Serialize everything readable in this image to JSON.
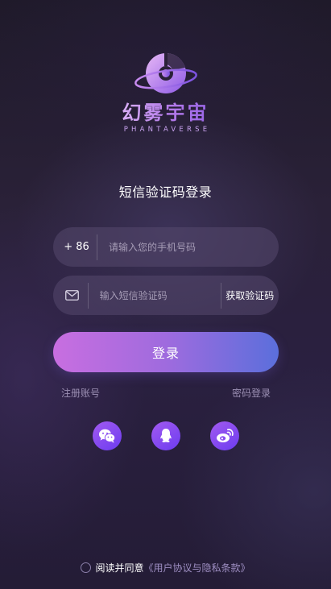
{
  "brand": {
    "name": "幻雾宇宙",
    "subtitle": "PHANTAVERSE"
  },
  "page": {
    "title": "短信验证码登录"
  },
  "phone": {
    "prefix": "+ 86",
    "placeholder": "请输入您的手机号码"
  },
  "code": {
    "icon": "envelope-icon",
    "placeholder": "输入短信验证码",
    "get_code_label": "获取验证码"
  },
  "login_button": "登录",
  "links": {
    "register": "注册账号",
    "password_login": "密码登录"
  },
  "social": [
    {
      "name": "wechat",
      "icon": "wechat-icon"
    },
    {
      "name": "qq",
      "icon": "qq-icon"
    },
    {
      "name": "weibo",
      "icon": "weibo-icon"
    }
  ],
  "agreement": {
    "text": "阅读并同意",
    "link": "《用户协议与隐私条款》"
  },
  "colors": {
    "accent_start": "#c86ee0",
    "accent_end": "#5b6fdc",
    "social_bg": "#8a4cf0"
  }
}
